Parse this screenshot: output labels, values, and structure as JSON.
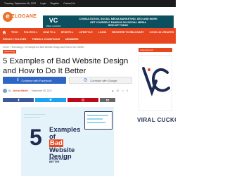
{
  "topbar": {
    "date": "Tuesday, September 06, 2022",
    "login": "Login",
    "register": "Register",
    "contact": "Contact Us"
  },
  "logo": {
    "letter": "e",
    "word": "ELOGANE",
    "accent": "#e8732a"
  },
  "banner": {
    "brand_mark": "VC",
    "brand_name": "VIRAL CUCKOO",
    "line1": "CONSULTATION, SOCIAL MEDIA MARKETING, SEO AND MORE",
    "line2": "GET YOURSELF FAMOUS ON SOCIAL MEDIA",
    "line3": "SIGN UP TODAY",
    "bg": "#0c4f5e"
  },
  "nav": {
    "row1": [
      "TECH",
      "POLITICS",
      "HOW TO",
      "SPORTS",
      "LIFESTYLE",
      "LOGIN",
      "REGISTER TO EBLOGARY",
      "COVID-19 UPDATES"
    ],
    "row2": [
      "PRIVACY POLICIES",
      "TERMS & CONDITIONS",
      "MEMBERS"
    ],
    "home_icon": "home-icon",
    "bg": "#e8461e"
  },
  "breadcrumb": "Home > Technology > 5 Examples of Bad Website Design and How to Do It Better",
  "category_tag": "Technology",
  "article": {
    "title": "5 Examples of Bad Website Design and How to Do It Better",
    "fb_button": "Continue with Facebook",
    "google_button": "Continue with Google",
    "author": "Jessica Martin",
    "date": "September 05, 2022",
    "views": "42",
    "comments": "0"
  },
  "art": {
    "number": "5",
    "word1": "Examples",
    "word2": "of",
    "word3": "Bad",
    "word4": "Website",
    "word5": "Design",
    "sub": "& HOW TO DO IT BETTER"
  },
  "sidebar": {
    "label": "Advertisement",
    "brand_mark": "VC",
    "brand_word": "VIRAL CUCKO"
  }
}
